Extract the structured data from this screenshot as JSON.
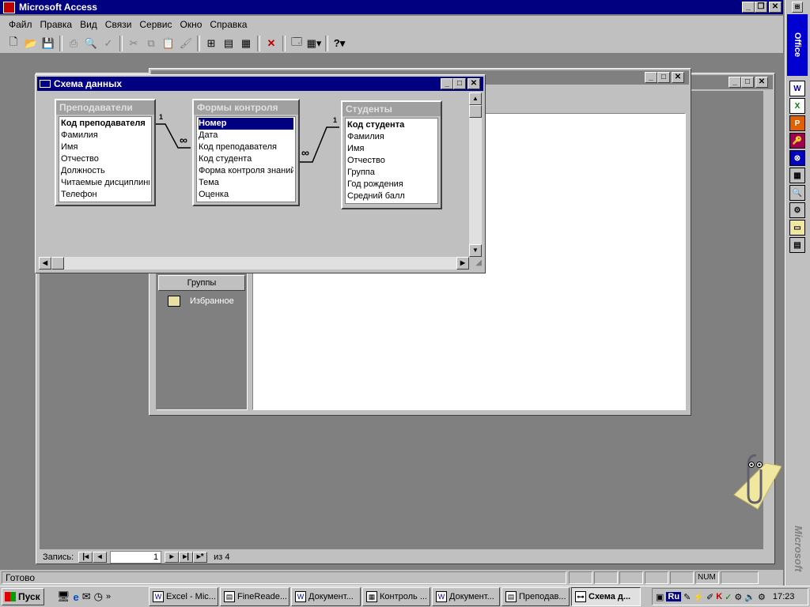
{
  "app": {
    "title": "Microsoft Access"
  },
  "menu": [
    "Файл",
    "Правка",
    "Вид",
    "Связи",
    "Сервис",
    "Окно",
    "Справка"
  ],
  "office_bar": {
    "label": "Office",
    "brand": "Microsoft"
  },
  "db_window": {
    "groups_label": "Группы",
    "favorites_label": "Избранное"
  },
  "record_nav": {
    "label": "Запись:",
    "current": "1",
    "of_label": "из 4"
  },
  "status": {
    "text": "Готово",
    "num": "NUM"
  },
  "schema": {
    "title": "Схема данных",
    "tables": [
      {
        "name": "Преподаватели",
        "fields": [
          "Код преподавателя",
          "Фамилия",
          "Имя",
          "Отчество",
          "Должность",
          "Читаемые дисциплины",
          "Телефон"
        ]
      },
      {
        "name": "Формы контроля",
        "fields": [
          "Номер",
          "Дата",
          "Код преподавателя",
          "Код студента",
          "Форма контроля знаний",
          "Тема",
          "Оценка"
        ]
      },
      {
        "name": "Студенты",
        "fields": [
          "Код студента",
          "Фамилия",
          "Имя",
          "Отчество",
          "Группа",
          "Год рождения",
          "Средний балл"
        ]
      }
    ],
    "rel_one": "1",
    "rel_many": "∞"
  },
  "taskbar": {
    "start": "Пуск",
    "items": [
      "Excel - Mic...",
      "FineReade...",
      "Документ...",
      "Контроль ...",
      "Документ...",
      "Преподав...",
      "Схема д..."
    ],
    "tray_lang": "Ru",
    "clock": "17:23"
  },
  "colors": {
    "titlebar": "#000080",
    "desktop": "#808080",
    "face": "#c0c0c0"
  }
}
